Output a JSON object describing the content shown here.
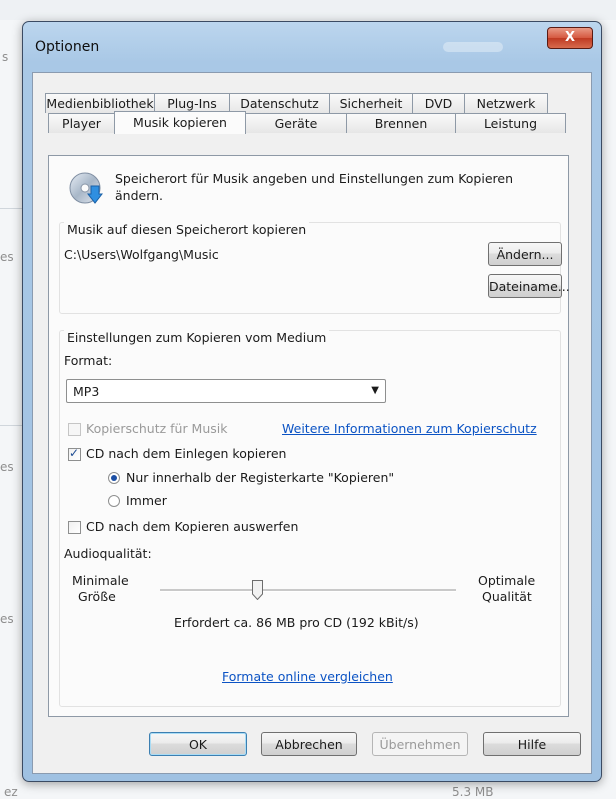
{
  "background": {
    "status_size": "5.3 MB",
    "fragment_es_1": "es",
    "fragment_es_2": "es",
    "fragment_es_3": "es",
    "fragment_ez": "ez",
    "fragment_s": "s"
  },
  "dialog": {
    "title": "Optionen",
    "close_label": "X"
  },
  "tabs": {
    "top_row": [
      "Medienbibliothek",
      "Plug-Ins",
      "Datenschutz",
      "Sicherheit",
      "DVD",
      "Netzwerk"
    ],
    "bottom_row": [
      "Player",
      "Musik kopieren",
      "Geräte",
      "Brennen",
      "Leistung"
    ],
    "active": "Musik kopieren"
  },
  "panel": {
    "description": "Speicherort für Musik angeben und Einstellungen zum Kopieren ändern.",
    "location_group": {
      "label": "Musik auf diesen Speicherort kopieren",
      "path": "C:\\Users\\Wolfgang\\Music",
      "change_button": "Ändern...",
      "filename_button": "Dateiname..."
    },
    "rip_group": {
      "label": "Einstellungen zum Kopieren vom Medium",
      "format_label": "Format:",
      "format_value": "MP3",
      "copy_protect_label": "Kopierschutz für Musik",
      "copy_protect_checked": false,
      "copy_protect_link": "Weitere Informationen zum Kopierschutz",
      "rip_on_insert_label": "CD nach dem Einlegen kopieren",
      "rip_on_insert_checked": true,
      "radio_only_tab_label": "Nur innerhalb der Registerkarte \"Kopieren\"",
      "radio_always_label": "Immer",
      "radio_selected": "only_tab",
      "eject_label": "CD nach dem Kopieren auswerfen",
      "eject_checked": false,
      "quality_label": "Audioqualität:",
      "min_label_1": "Minimale",
      "min_label_2": "Größe",
      "max_label_1": "Optimale",
      "max_label_2": "Qualität",
      "quality_level": 0.33,
      "requirement_text": "Erfordert ca. 86 MB pro CD (192 kBit/s)",
      "compare_link": "Formate online vergleichen"
    }
  },
  "footer": {
    "ok": "OK",
    "cancel": "Abbrechen",
    "apply": "Übernehmen",
    "help": "Hilfe"
  }
}
